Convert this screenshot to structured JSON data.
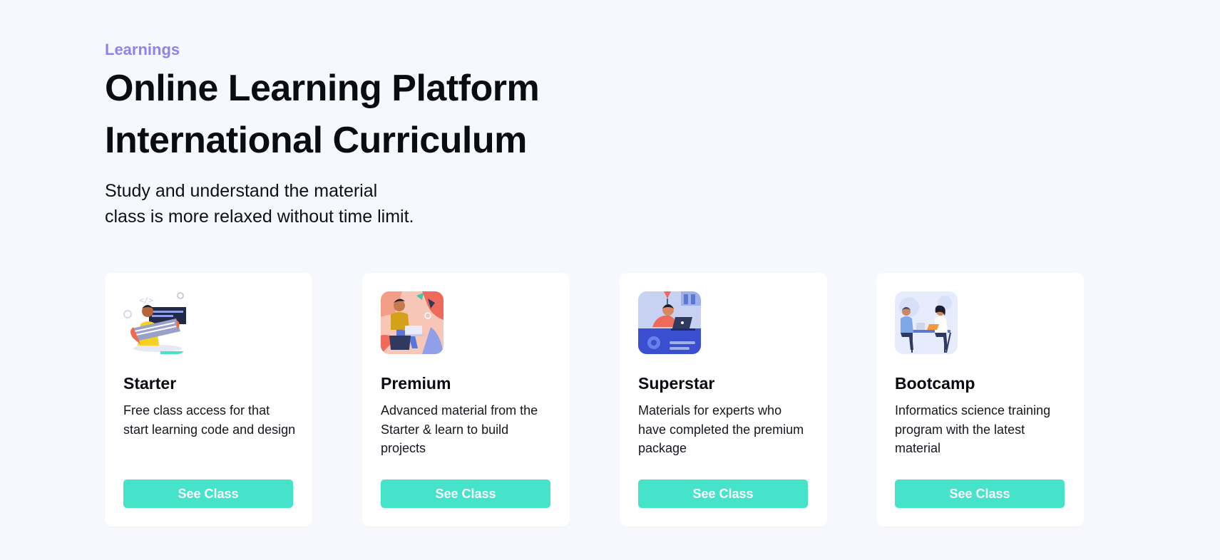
{
  "section": {
    "eyebrow": "Learnings",
    "headline_line1": "Online Learning Platform",
    "headline_line2": "International Curriculum",
    "subtitle_line1": "Study and understand the material",
    "subtitle_line2": "class is more relaxed without time limit."
  },
  "cards": [
    {
      "title": "Starter",
      "description": "Free class access for that start learning code and design",
      "button_label": "See Class",
      "illustration": "developer-with-keyboard-illustration"
    },
    {
      "title": "Premium",
      "description": "Advanced material from the Starter & learn to build projects",
      "button_label": "See Class",
      "illustration": "person-with-laptop-illustration"
    },
    {
      "title": "Superstar",
      "description": "Materials for experts who have completed the premium package",
      "button_label": "See Class",
      "illustration": "engineer-at-desk-illustration"
    },
    {
      "title": "Bootcamp",
      "description": "Informatics science training program with the latest material",
      "button_label": "See Class",
      "illustration": "team-meeting-illustration"
    }
  ],
  "colors": {
    "background": "#f7f8fd",
    "eyebrow": "#8c84ea",
    "accent_button": "#45e3c9",
    "card": "#ffffff",
    "text": "#0b0b12"
  }
}
